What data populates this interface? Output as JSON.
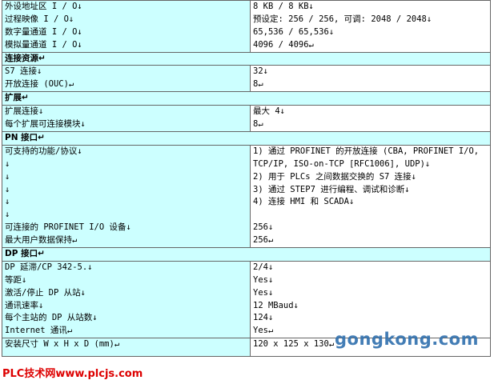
{
  "rows": [
    {
      "type": "pair",
      "label": [
        "外设地址区 I / O↓",
        "过程映像 I / O↓",
        "数字量通道 I / O↓",
        "模拟量通道 I / O↓"
      ],
      "value": [
        "8 KB / 8 KB↓",
        "预设定: 256 / 256, 可调: 2048 / 2048↓",
        "65,536 / 65,536↓",
        "4096 / 4096↵"
      ]
    },
    {
      "type": "section",
      "title": "连接资源↵"
    },
    {
      "type": "pair",
      "label": [
        "S7 连接↓",
        "开放连接 (OUC)↵"
      ],
      "value": [
        "32↓",
        "8↵"
      ]
    },
    {
      "type": "section",
      "title": "扩展↵"
    },
    {
      "type": "pair",
      "label": [
        "扩展连接↓",
        "每个扩展可连接模块↓"
      ],
      "value": [
        "最大 4↓",
        "8↵"
      ]
    },
    {
      "type": "section",
      "title": "PN 接口↵"
    },
    {
      "type": "pair",
      "label": [
        "可支持的功能/协议↓",
        "↓",
        "↓",
        "↓",
        "↓",
        "↓",
        "可连接的 PROFINET I/O 设备↓",
        "最大用户数据保持↵"
      ],
      "value": [
        "1) 通过 PROFINET 的开放连接 (CBA, PROFINET I/O,",
        "TCP/IP, ISO-on-TCP [RFC1006], UDP)↓",
        "2) 用于 PLCs 之间数据交换的 S7 连接↓",
        "3) 通过 STEP7 进行编程、调试和诊断↓",
        "4) 连接 HMI 和 SCADA↓",
        "",
        "256↓",
        "256↵"
      ]
    },
    {
      "type": "section",
      "title": "DP 接口↵"
    },
    {
      "type": "pair",
      "label": [
        "DP 延滞/CP 342-5.↓",
        "等距↓",
        "激活/停止 DP 从站↓",
        "通讯速率↓",
        "每个主站的 DP 从站数↓",
        "Internet 通讯↵"
      ],
      "value": [
        "2/4↓",
        "Yes↓",
        "Yes↓",
        "12 MBaud↓",
        "124↓",
        "Yes↵"
      ]
    },
    {
      "type": "pair",
      "label": [
        "安装尺寸 W x H x D (mm)↵"
      ],
      "value": [
        "120 x 125 x 130↵"
      ]
    }
  ],
  "watermarks": {
    "site1": "gongkong.com",
    "site2": "PLC技术网www.plcjs.com"
  }
}
